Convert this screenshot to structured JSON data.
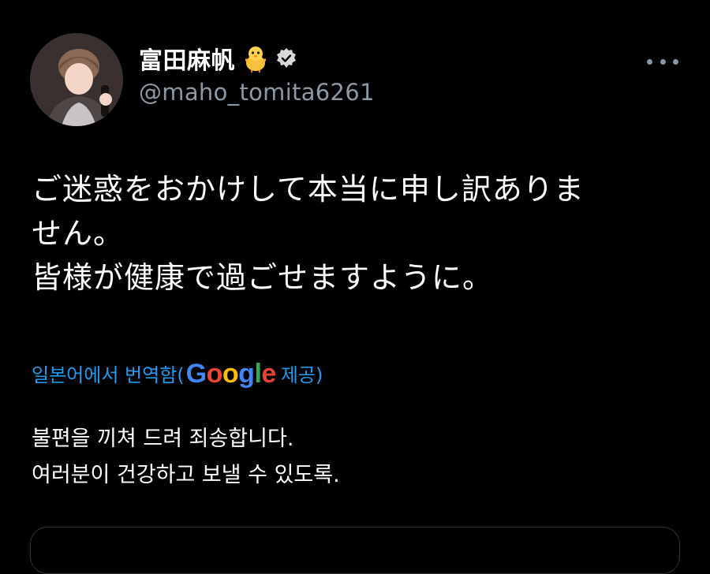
{
  "author": {
    "display_name": "富田麻帆",
    "emoji_icon": "baby-chick-icon",
    "verified_icon": "verified-badge-icon",
    "handle": "@maho_tomita6261",
    "avatar": "avatar-photo"
  },
  "tweet": {
    "text": "ご迷惑をおかけして本当に申し訳ありま\nせん。\n皆様が健康で過ごせますように。"
  },
  "translation": {
    "prefix": "일본어에서 번역함(",
    "provider_logo": "Google",
    "suffix": "제공)",
    "text": "불편을 끼쳐 드려 죄송합니다.\n여러분이 건강하고 보낼 수 있도록."
  },
  "colors": {
    "background": "#000000",
    "text": "#ffffff",
    "secondary": "#8b98a5",
    "link": "#1d9bf0"
  },
  "icons": {
    "more": "more-horizontal-icon"
  }
}
